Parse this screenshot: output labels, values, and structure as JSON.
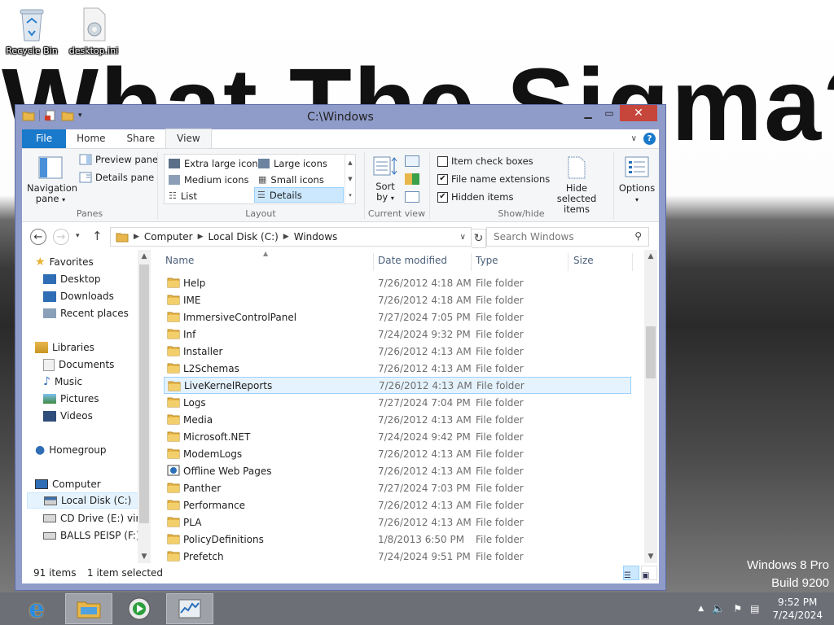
{
  "desktop": {
    "wallpaper_text": "What The Sigma?",
    "icons": [
      {
        "label": "Recycle Bin",
        "icon": "recycle-bin-icon"
      },
      {
        "label": "desktop.ini",
        "icon": "ini-file-icon"
      }
    ],
    "watermark": {
      "line1": "Windows 8 Pro",
      "line2": "Build 9200"
    }
  },
  "window": {
    "title": "C:\\Windows",
    "tabs": [
      "File",
      "Home",
      "Share",
      "View"
    ],
    "active_tab": "View"
  },
  "ribbon": {
    "panes": {
      "navigation_pane": "Navigation pane",
      "preview_pane": "Preview pane",
      "details_pane": "Details pane",
      "label": "Panes"
    },
    "layout": {
      "items": [
        "Extra large icons",
        "Large icons",
        "Medium icons",
        "Small icons",
        "List",
        "Details"
      ],
      "selected": "Details",
      "label": "Layout"
    },
    "current_view": {
      "sort_by": "Sort by",
      "label": "Current view"
    },
    "show_hide": {
      "item_check_boxes": {
        "label": "Item check boxes",
        "checked": false
      },
      "file_name_extensions": {
        "label": "File name extensions",
        "checked": true
      },
      "hidden_items": {
        "label": "Hidden items",
        "checked": true
      },
      "hide_selected": "Hide selected items",
      "label": "Show/hide"
    },
    "options": "Options"
  },
  "address": {
    "breadcrumbs": [
      "Computer",
      "Local Disk (C:)",
      "Windows"
    ],
    "search_placeholder": "Search Windows"
  },
  "nav": {
    "favorites": "Favorites",
    "favorites_items": [
      "Desktop",
      "Downloads",
      "Recent places"
    ],
    "libraries": "Libraries",
    "libraries_items": [
      "Documents",
      "Music",
      "Pictures",
      "Videos"
    ],
    "homegroup": "Homegroup",
    "computer": "Computer",
    "computer_items": [
      "Local Disk (C:)",
      "CD Drive (E:) virti",
      "BALLS PEISP (F:)"
    ]
  },
  "columns": {
    "name": "Name",
    "date": "Date modified",
    "type": "Type",
    "size": "Size"
  },
  "files": [
    {
      "name": "Help",
      "date": "7/26/2012 4:18 AM",
      "type": "File folder"
    },
    {
      "name": "IME",
      "date": "7/26/2012 4:18 AM",
      "type": "File folder"
    },
    {
      "name": "ImmersiveControlPanel",
      "date": "7/27/2024 7:05 PM",
      "type": "File folder"
    },
    {
      "name": "Inf",
      "date": "7/24/2024 9:32 PM",
      "type": "File folder"
    },
    {
      "name": "Installer",
      "date": "7/26/2012 4:13 AM",
      "type": "File folder"
    },
    {
      "name": "L2Schemas",
      "date": "7/26/2012 4:13 AM",
      "type": "File folder"
    },
    {
      "name": "LiveKernelReports",
      "date": "7/26/2012 4:13 AM",
      "type": "File folder"
    },
    {
      "name": "Logs",
      "date": "7/27/2024 7:04 PM",
      "type": "File folder"
    },
    {
      "name": "Media",
      "date": "7/26/2012 4:13 AM",
      "type": "File folder"
    },
    {
      "name": "Microsoft.NET",
      "date": "7/24/2024 9:42 PM",
      "type": "File folder"
    },
    {
      "name": "ModemLogs",
      "date": "7/26/2012 4:13 AM",
      "type": "File folder"
    },
    {
      "name": "Offline Web Pages",
      "date": "7/26/2012 4:13 AM",
      "type": "File folder"
    },
    {
      "name": "Panther",
      "date": "7/27/2024 7:03 PM",
      "type": "File folder"
    },
    {
      "name": "Performance",
      "date": "7/26/2012 4:13 AM",
      "type": "File folder"
    },
    {
      "name": "PLA",
      "date": "7/26/2012 4:13 AM",
      "type": "File folder"
    },
    {
      "name": "PolicyDefinitions",
      "date": "1/8/2013 6:50 PM",
      "type": "File folder"
    },
    {
      "name": "Prefetch",
      "date": "7/24/2024 9:51 PM",
      "type": "File folder"
    }
  ],
  "status": {
    "items": "91 items",
    "selected": "1 item selected"
  },
  "taskbar": {
    "time": "9:52 PM",
    "date": "7/24/2024"
  },
  "colors": {
    "accent": "#1979ca",
    "selection": "#cce8ff",
    "close": "#c7463c",
    "taskbar": "#6d6f77"
  }
}
